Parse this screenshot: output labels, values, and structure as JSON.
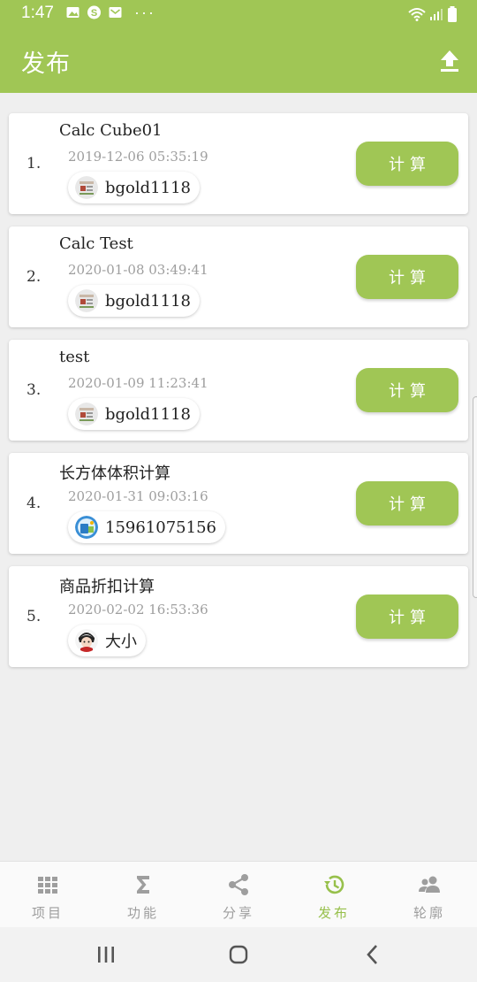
{
  "status_bar": {
    "time": "1:47",
    "dots": "···",
    "icons": [
      "image-icon",
      "skype-icon",
      "mail-icon",
      "wifi-icon",
      "signal-icon",
      "battery-icon"
    ]
  },
  "app_bar": {
    "title": "发布",
    "action_icon": "upload-icon"
  },
  "items": [
    {
      "index": "1.",
      "title": "Calc Cube01",
      "time": "2019-12-06 05:35:19",
      "author": "bgold1118",
      "button": "计算"
    },
    {
      "index": "2.",
      "title": "Calc Test",
      "time": "2020-01-08 03:49:41",
      "author": "bgold1118",
      "button": "计算"
    },
    {
      "index": "3.",
      "title": "test",
      "time": "2020-01-09 11:23:41",
      "author": "bgold1118",
      "button": "计算"
    },
    {
      "index": "4.",
      "title": "长方体体积计算",
      "time": "2020-01-31 09:03:16",
      "author": "15961075156",
      "button": "计算"
    },
    {
      "index": "5.",
      "title": "商品折扣计算",
      "time": "2020-02-02 16:53:36",
      "author": "大小",
      "button": "计算"
    }
  ],
  "bottom_nav": [
    {
      "label": "项目",
      "icon": "grid-icon",
      "active": false
    },
    {
      "label": "功能",
      "icon": "sigma-icon",
      "active": false
    },
    {
      "label": "分享",
      "icon": "share-icon",
      "active": false
    },
    {
      "label": "发布",
      "icon": "history-icon",
      "active": true
    },
    {
      "label": "轮廓",
      "icon": "people-icon",
      "active": false
    }
  ],
  "colors": {
    "accent": "#a0c655",
    "active_tab": "#97c04b",
    "inactive_tab": "#9e9e9e",
    "background": "#efefef"
  }
}
